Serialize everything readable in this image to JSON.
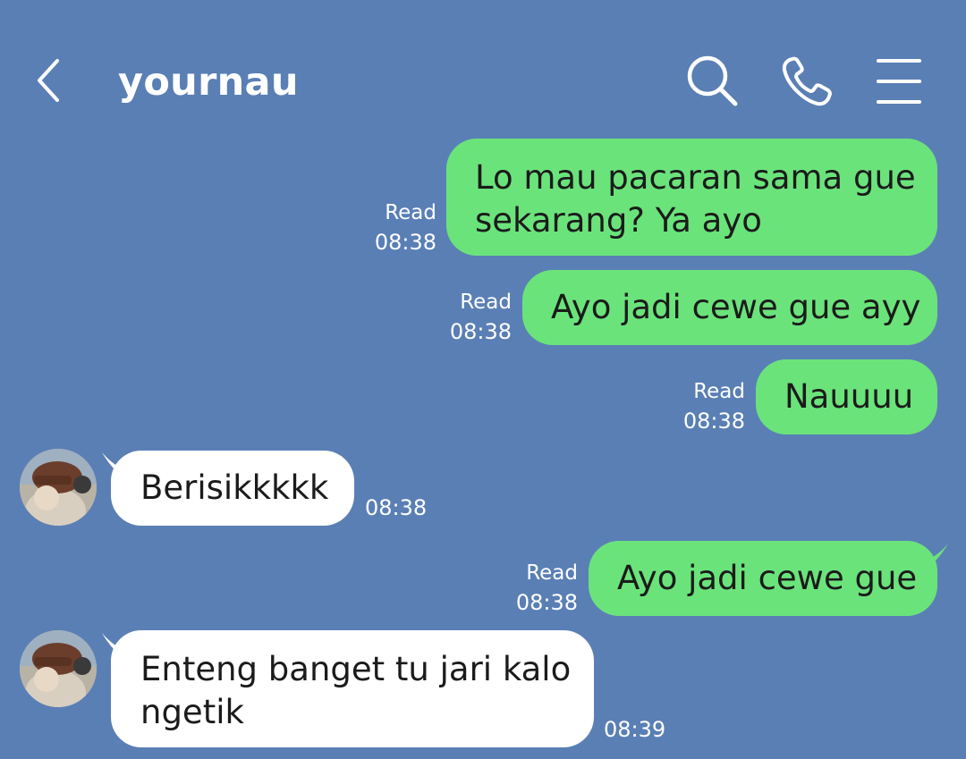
{
  "header": {
    "title": "yournau",
    "back_icon": "chevron-left-icon",
    "search_icon": "search-icon",
    "call_icon": "phone-icon",
    "menu_icon": "menu-icon"
  },
  "colors": {
    "background": "#5a7fb5",
    "outgoing_bubble": "#6be37b",
    "incoming_bubble": "#ffffff",
    "meta_text": "#ffffff"
  },
  "messages": [
    {
      "direction": "out",
      "lines": [
        "Lo mau pacaran sama gue",
        "sekarang? Ya ayo"
      ],
      "status": "Read",
      "time": "08:38"
    },
    {
      "direction": "out",
      "lines": [
        "Ayo jadi cewe gue ayy"
      ],
      "status": "Read",
      "time": "08:38"
    },
    {
      "direction": "out",
      "lines": [
        "Nauuuu"
      ],
      "status": "Read",
      "time": "08:38"
    },
    {
      "direction": "in",
      "lines": [
        "Berisikkkkk"
      ],
      "time": "08:38"
    },
    {
      "direction": "out",
      "lines": [
        "Ayo jadi cewe gue"
      ],
      "status": "Read",
      "time": "08:38"
    },
    {
      "direction": "in",
      "lines": [
        "Enteng banget tu jari kalo",
        "ngetik"
      ],
      "time": "08:39"
    }
  ]
}
